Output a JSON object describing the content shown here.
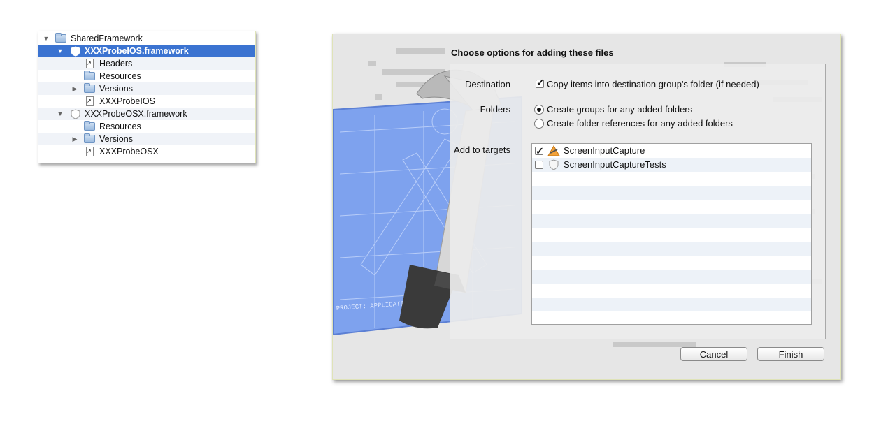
{
  "navigator": {
    "items": [
      {
        "label": "SharedFramework",
        "icon": "folder-icon",
        "disclosure": "▼"
      },
      {
        "label": "XXXProbeIOS.framework",
        "icon": "framework-icon",
        "disclosure": "▼"
      },
      {
        "label": "Headers",
        "icon": "file-alias-icon",
        "disclosure": ""
      },
      {
        "label": "Resources",
        "icon": "folder-alias-icon",
        "disclosure": ""
      },
      {
        "label": "Versions",
        "icon": "folder-icon",
        "disclosure": "▶"
      },
      {
        "label": "XXXProbeIOS",
        "icon": "file-alias-icon",
        "disclosure": ""
      },
      {
        "label": "XXXProbeOSX.framework",
        "icon": "framework-icon",
        "disclosure": "▼"
      },
      {
        "label": "Resources",
        "icon": "folder-alias-icon",
        "disclosure": ""
      },
      {
        "label": "Versions",
        "icon": "folder-icon",
        "disclosure": "▶"
      },
      {
        "label": "XXXProbeOSX",
        "icon": "file-alias-icon",
        "disclosure": ""
      }
    ],
    "selected_index": 1,
    "selection_color": "#3b73d1"
  },
  "dialog": {
    "title": "Choose options for adding these files",
    "destination": {
      "label": "Destination",
      "copy_label": "Copy items into destination group's folder (if needed)",
      "copy_checked": true
    },
    "folders": {
      "label": "Folders",
      "options": [
        {
          "label": "Create groups for any added folders",
          "selected": true
        },
        {
          "label": "Create folder references for any added folders",
          "selected": false
        }
      ]
    },
    "targets": {
      "label": "Add to targets",
      "items": [
        {
          "name": "ScreenInputCapture",
          "checked": true,
          "icon": "app-target-icon"
        },
        {
          "name": "ScreenInputCaptureTests",
          "checked": false,
          "icon": "test-bundle-icon"
        }
      ]
    },
    "buttons": {
      "cancel": "Cancel",
      "finish": "Finish"
    },
    "background_art": {
      "blueprint_caption": "PROJECT: APPLICATION.APP",
      "colors": {
        "blueprint": "#6f95e8",
        "hammer_handle": "#3a3a3a"
      }
    }
  }
}
